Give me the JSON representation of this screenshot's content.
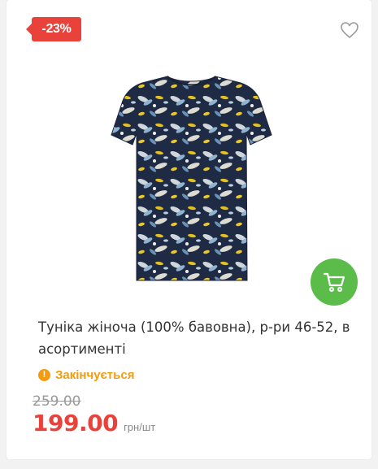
{
  "product": {
    "discount_badge": "-23%",
    "title": "Туніка жіноча (100% бавовна), р-ри 46-52, в асортименті",
    "status": "Закінчується",
    "old_price": "259.00",
    "price": "199.00",
    "unit": "грн/шт"
  },
  "colors": {
    "accent_red": "#e8423b",
    "cart_green": "#5cbc4a",
    "status_orange": "#f39c12"
  },
  "icons": {
    "favorite": "heart-outline-icon",
    "cart": "shopping-cart-icon",
    "status": "exclamation-circle-icon"
  }
}
